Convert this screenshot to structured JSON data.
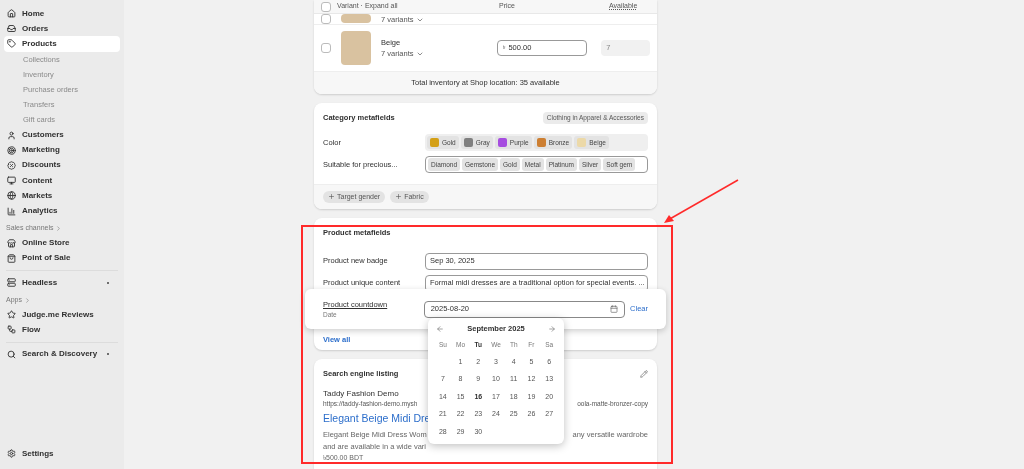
{
  "sidebar": {
    "items": [
      {
        "kind": "item",
        "label": "Home",
        "selected": false
      },
      {
        "kind": "item",
        "label": "Orders",
        "selected": false
      },
      {
        "kind": "item",
        "label": "Products",
        "selected": true
      },
      {
        "kind": "subitem",
        "label": "Collections",
        "selected": false
      },
      {
        "kind": "subitem",
        "label": "Inventory",
        "selected": false
      },
      {
        "kind": "subitem",
        "label": "Purchase orders",
        "selected": false
      },
      {
        "kind": "subitem",
        "label": "Transfers",
        "selected": false
      },
      {
        "kind": "subitem",
        "label": "Gift cards",
        "selected": false
      },
      {
        "kind": "item",
        "label": "Customers",
        "selected": false
      },
      {
        "kind": "item",
        "label": "Marketing",
        "selected": false
      },
      {
        "kind": "item",
        "label": "Discounts",
        "selected": false
      },
      {
        "kind": "item",
        "label": "Content",
        "selected": false
      },
      {
        "kind": "item",
        "label": "Markets",
        "selected": false
      },
      {
        "kind": "item",
        "label": "Analytics",
        "selected": false
      },
      {
        "kind": "section",
        "label": "Sales channels"
      },
      {
        "kind": "item",
        "label": "Online Store",
        "selected": false
      },
      {
        "kind": "item",
        "label": "Point of Sale",
        "selected": false
      },
      {
        "kind": "divider"
      },
      {
        "kind": "item",
        "label": "Headless",
        "selected": false,
        "pinned": true
      },
      {
        "kind": "section",
        "label": "Apps"
      },
      {
        "kind": "item",
        "label": "Judge.me Reviews",
        "selected": false
      },
      {
        "kind": "item",
        "label": "Flow",
        "selected": false
      },
      {
        "kind": "divider"
      },
      {
        "kind": "item",
        "label": "Search & Discovery",
        "selected": false,
        "pinned": true
      }
    ],
    "settings": "Settings"
  },
  "variants": {
    "header": {
      "checked": false,
      "variant": "Variant · Expand all",
      "price": "Price",
      "available": "Available"
    },
    "rows": [
      {
        "checked": false,
        "count": "7 variants"
      },
      {
        "checked": false,
        "name": "Beige",
        "count": "7 variants",
        "currency": "৳",
        "price": "500.00",
        "available": "7"
      }
    ],
    "total": "Total inventory at Shop location: 35 available"
  },
  "category_metafields": {
    "title": "Category metafields",
    "badge": "Clothing in Apparel & Accessories",
    "fields": [
      {
        "kind": "colors",
        "label": "Color",
        "tags": [
          {
            "label": "Gold",
            "color": "#d4a017"
          },
          {
            "label": "Gray",
            "color": "#808080"
          },
          {
            "label": "Purple",
            "color": "#a64de0"
          },
          {
            "label": "Bronze",
            "color": "#cd7f32"
          },
          {
            "label": "Beige",
            "color": "#ecd9a8"
          }
        ]
      },
      {
        "kind": "tags",
        "label": "Suitable for precious...",
        "tags": [
          {
            "label": "Diamond"
          },
          {
            "label": "Gemstone"
          },
          {
            "label": "Gold"
          },
          {
            "label": "Metal"
          },
          {
            "label": "Platinum"
          },
          {
            "label": "Silver"
          },
          {
            "label": "Soft gem"
          }
        ]
      }
    ],
    "add_buttons": [
      "Target gender",
      "Fabric"
    ]
  },
  "product_metafields": {
    "title": "Product metafields",
    "fields": [
      {
        "label": "Product new badge",
        "value": "Sep 30, 2025"
      },
      {
        "label": "Product unique content",
        "value": "Formal midi dresses are a traditional option for special events. ..."
      }
    ],
    "active_field": {
      "label": "Product countdown",
      "type": "Date",
      "value": "2025-08-20",
      "clear": "Clear"
    },
    "view_all": "View all"
  },
  "calendar": {
    "month": "September 2025",
    "weekdays": [
      {
        "label": "Su",
        "current": false
      },
      {
        "label": "Mo",
        "current": false
      },
      {
        "label": "Tu",
        "current": true
      },
      {
        "label": "We",
        "current": false
      },
      {
        "label": "Th",
        "current": false
      },
      {
        "label": "Fr",
        "current": false
      },
      {
        "label": "Sa",
        "current": false
      }
    ],
    "weeks": [
      [
        {
          "day": "1",
          "today": false
        },
        {
          "day": "2",
          "today": false
        },
        {
          "day": "3",
          "today": false
        },
        {
          "day": "4",
          "today": false
        },
        {
          "day": "5",
          "today": false
        },
        {
          "day": "6",
          "today": false
        }
      ],
      [
        {
          "day": "7",
          "today": false
        },
        {
          "day": "8",
          "today": false
        },
        {
          "day": "9",
          "today": false
        },
        {
          "day": "10",
          "today": false
        },
        {
          "day": "11",
          "today": false
        },
        {
          "day": "12",
          "today": false
        },
        {
          "day": "13",
          "today": false
        }
      ],
      [
        {
          "day": "14",
          "today": false
        },
        {
          "day": "15",
          "today": false
        },
        {
          "day": "16",
          "today": true
        },
        {
          "day": "17",
          "today": false
        },
        {
          "day": "18",
          "today": false
        },
        {
          "day": "19",
          "today": false
        },
        {
          "day": "20",
          "today": false
        }
      ],
      [
        {
          "day": "21",
          "today": false
        },
        {
          "day": "22",
          "today": false
        },
        {
          "day": "23",
          "today": false
        },
        {
          "day": "24",
          "today": false
        },
        {
          "day": "25",
          "today": false
        },
        {
          "day": "26",
          "today": false
        },
        {
          "day": "27",
          "today": false
        }
      ],
      [
        {
          "day": "28",
          "today": false
        },
        {
          "day": "29",
          "today": false
        },
        {
          "day": "30",
          "today": false
        }
      ]
    ]
  },
  "seo": {
    "title": "Search engine listing",
    "site": "Taddy Fashion Demo",
    "url_parts": [
      "https://taddy-fashion-demo.mysh",
      "oola-matte-bronzer-copy"
    ],
    "page_title": "Elegant Beige Midi Dre",
    "description_lines": [
      [
        "Elegant Beige Midi Dress Wom",
        "any versatile wardrobe"
      ],
      [
        "and are available in a wide vari"
      ]
    ],
    "price": "৳500.00 BDT"
  }
}
